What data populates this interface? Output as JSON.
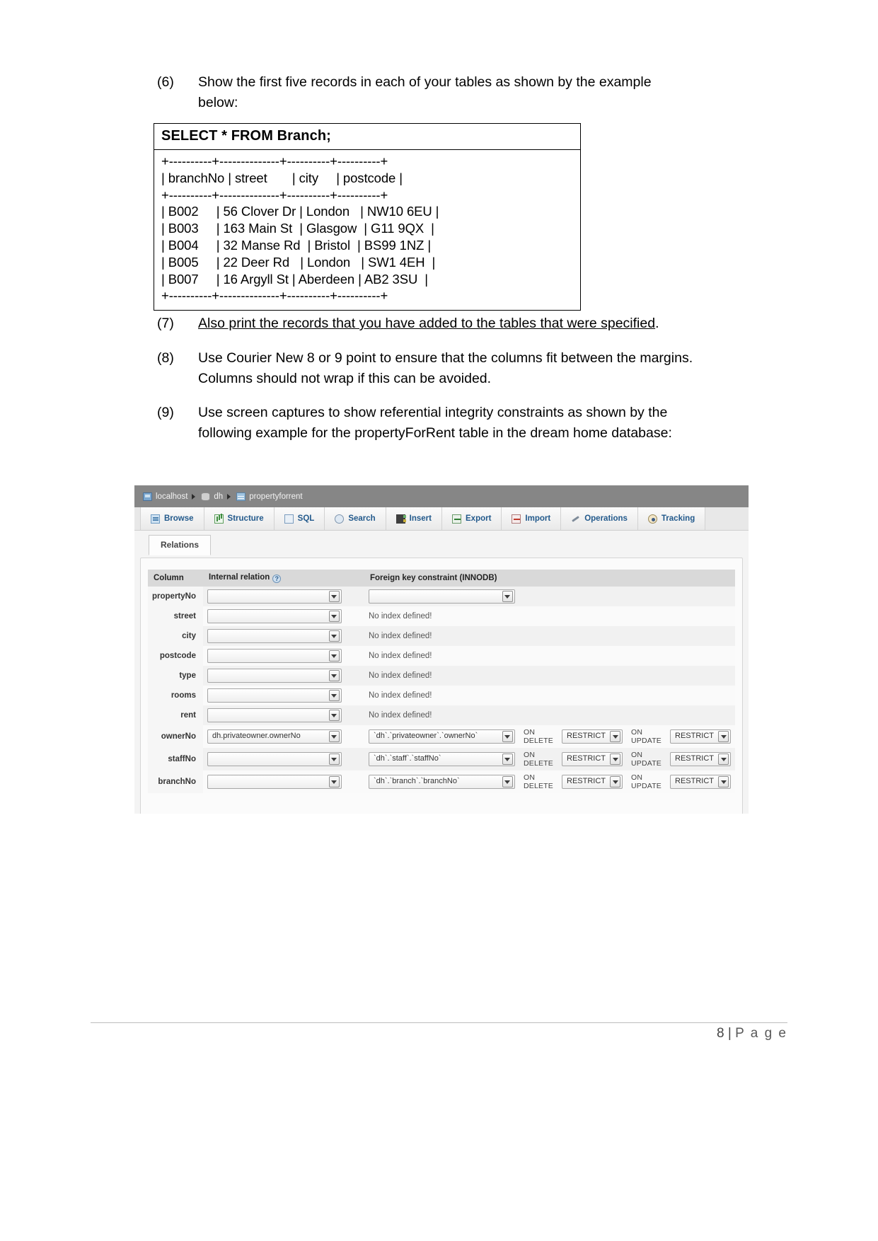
{
  "document": {
    "items": [
      {
        "number": "(6)",
        "text": "Show the first five records in each of your tables as shown by the example below:",
        "underlined": false
      },
      {
        "number": "(7)",
        "text": "Also print the records that you have added to the tables that were specified",
        "trailing": ".",
        "underlined": true
      },
      {
        "number": "(8)",
        "text": "Use Courier New 8 or 9 point to ensure that the columns fit between the margins.  Columns should not wrap if this can be avoided.",
        "underlined": false
      },
      {
        "number": "(9)",
        "text": "Use screen captures to show referential integrity constraints as shown by the following example for the propertyForRent table in the dream home database:",
        "underlined": false
      }
    ]
  },
  "sql_result": {
    "title": "SELECT * FROM Branch;",
    "body": "+----------+--------------+----------+----------+\n| branchNo | street       | city     | postcode |\n+----------+--------------+----------+----------+\n| B002     | 56 Clover Dr | London   | NW10 6EU |\n| B003     | 163 Main St  | Glasgow  | G11 9QX  |\n| B004     | 32 Manse Rd  | Bristol  | BS99 1NZ |\n| B005     | 22 Deer Rd   | London   | SW1 4EH  |\n| B007     | 16 Argyll St | Aberdeen | AB2 3SU  |\n+----------+--------------+----------+----------+",
    "columns": [
      "branchNo",
      "street",
      "city",
      "postcode"
    ],
    "rows": [
      [
        "B002",
        "56 Clover Dr",
        "London",
        "NW10 6EU"
      ],
      [
        "B003",
        "163 Main St",
        "Glasgow",
        "G11 9QX"
      ],
      [
        "B004",
        "32 Manse Rd",
        "Bristol",
        "BS99 1NZ"
      ],
      [
        "B005",
        "22 Deer Rd",
        "London",
        "SW1 4EH"
      ],
      [
        "B007",
        "16 Argyll St",
        "Aberdeen",
        "AB2 3SU"
      ]
    ]
  },
  "phpmyadmin": {
    "breadcrumb": {
      "server": "localhost",
      "database": "dh",
      "table": "propertyforrent"
    },
    "tabs": [
      {
        "label": "Browse",
        "icon": "browse-icon"
      },
      {
        "label": "Structure",
        "icon": "structure-icon"
      },
      {
        "label": "SQL",
        "icon": "sql-icon"
      },
      {
        "label": "Search",
        "icon": "search-icon"
      },
      {
        "label": "Insert",
        "icon": "insert-icon"
      },
      {
        "label": "Export",
        "icon": "export-icon"
      },
      {
        "label": "Import",
        "icon": "import-icon"
      },
      {
        "label": "Operations",
        "icon": "operations-icon"
      },
      {
        "label": "Tracking",
        "icon": "tracking-icon"
      }
    ],
    "subtab": "Relations",
    "table_headers": {
      "column": "Column",
      "internal_relation": "Internal relation",
      "foreign_key": "Foreign key constraint (INNODB)"
    },
    "no_index_text": "No index defined!",
    "on_delete_label": "ON DELETE",
    "on_update_label": "ON UPDATE",
    "rows": [
      {
        "column": "propertyNo",
        "internal": "",
        "fk": "",
        "no_index": false,
        "has_actions": false,
        "on_delete": "",
        "on_update": ""
      },
      {
        "column": "street",
        "internal": "",
        "fk": "",
        "no_index": true,
        "has_actions": false,
        "on_delete": "",
        "on_update": ""
      },
      {
        "column": "city",
        "internal": "",
        "fk": "",
        "no_index": true,
        "has_actions": false,
        "on_delete": "",
        "on_update": ""
      },
      {
        "column": "postcode",
        "internal": "",
        "fk": "",
        "no_index": true,
        "has_actions": false,
        "on_delete": "",
        "on_update": ""
      },
      {
        "column": "type",
        "internal": "",
        "fk": "",
        "no_index": true,
        "has_actions": false,
        "on_delete": "",
        "on_update": ""
      },
      {
        "column": "rooms",
        "internal": "",
        "fk": "",
        "no_index": true,
        "has_actions": false,
        "on_delete": "",
        "on_update": ""
      },
      {
        "column": "rent",
        "internal": "",
        "fk": "",
        "no_index": true,
        "has_actions": false,
        "on_delete": "",
        "on_update": ""
      },
      {
        "column": "ownerNo",
        "internal": "dh.privateowner.ownerNo",
        "fk": "`dh`.`privateowner`.`ownerNo`",
        "no_index": false,
        "has_actions": true,
        "on_delete": "RESTRICT",
        "on_update": "RESTRICT"
      },
      {
        "column": "staffNo",
        "internal": "",
        "fk": "`dh`.`staff`.`staffNo`",
        "no_index": false,
        "has_actions": true,
        "on_delete": "RESTRICT",
        "on_update": "RESTRICT"
      },
      {
        "column": "branchNo",
        "internal": "",
        "fk": "`dh`.`branch`.`branchNo`",
        "no_index": false,
        "has_actions": true,
        "on_delete": "RESTRICT",
        "on_update": "RESTRICT"
      }
    ]
  },
  "footer": {
    "page_number": "8",
    "separator": "|",
    "page_word": "P a g e"
  }
}
